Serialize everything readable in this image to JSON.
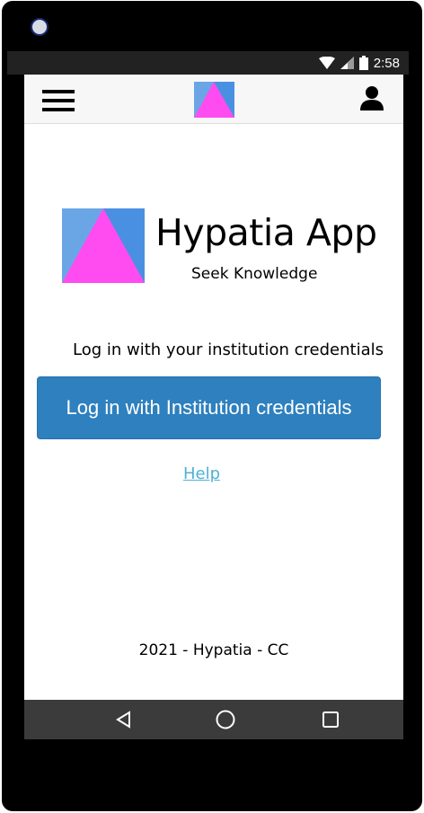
{
  "status_bar": {
    "time": "2:58"
  },
  "icons": {
    "menu": "hamburger-menu-icon",
    "user": "user-account-icon",
    "logo": "hypatia-triangle-logo",
    "back": "back-triangle-icon",
    "home": "home-circle-icon",
    "recents": "recents-square-icon"
  },
  "colors": {
    "logo_background": "#4a90e2",
    "logo_triangle": "#ff4cf0",
    "button": "#2e80be",
    "link": "#4eb1d6"
  },
  "brand": {
    "title": "Hypatia App",
    "subtitle": "Seek Knowledge"
  },
  "login": {
    "prompt": "Log in with your institution credentials",
    "button_label": "Log in with Institution credentials"
  },
  "help": {
    "label": "Help"
  },
  "footer": {
    "text": "2021 - Hypatia - CC"
  }
}
